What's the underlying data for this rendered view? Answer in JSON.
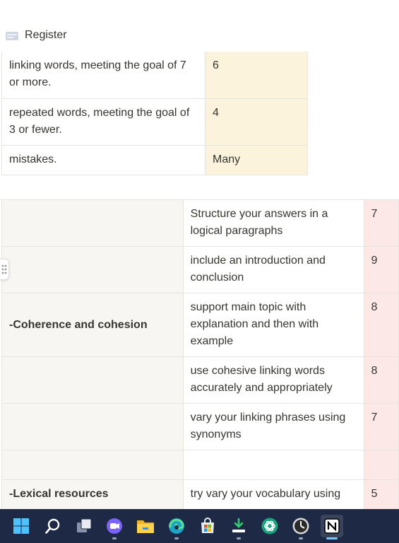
{
  "header": {
    "title": "Register"
  },
  "table_top": {
    "rows": [
      {
        "label": "linking words, meeting the goal of 7 or more.",
        "value": "6"
      },
      {
        "label": "repeated  words, meeting the goal of 3 or fewer.",
        "value": "4"
      },
      {
        "label": "mistakes.",
        "value": "Many"
      }
    ]
  },
  "table_main": {
    "rows": [
      {
        "category": "",
        "criterion": "Structure your answers in a logical paragraphs",
        "score": "7"
      },
      {
        "category": "",
        "criterion": "include an introduction and conclusion",
        "score": "9"
      },
      {
        "category": "-Coherence and cohesion",
        "criterion": "support main topic with explanation and then with example",
        "score": "8"
      },
      {
        "category": "",
        "criterion": "use cohesive linking words accurately and appropriately",
        "score": "8"
      },
      {
        "category": "",
        "criterion": "vary your linking phrases using synonyms",
        "score": "7"
      },
      {
        "category": "",
        "criterion": "",
        "score": ""
      },
      {
        "category": "-Lexical resources",
        "criterion": "try vary your vocabulary using",
        "score": "5"
      }
    ]
  },
  "taskbar": {
    "icons": [
      "windows-start-icon",
      "search-icon",
      "task-view-icon",
      "chat-icon",
      "file-explorer-icon",
      "edge-icon",
      "store-icon",
      "downloader-icon",
      "ai-app-icon",
      "clock-app-icon",
      "notion-icon"
    ]
  }
}
